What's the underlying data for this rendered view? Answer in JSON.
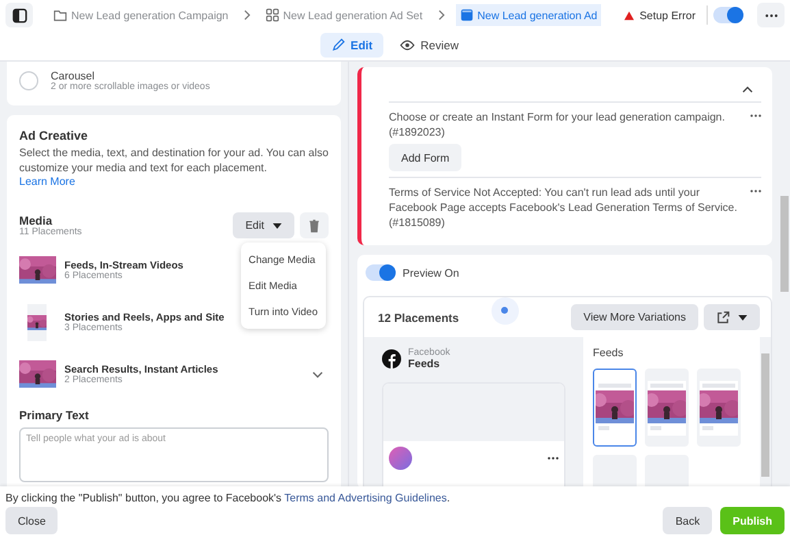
{
  "topbar": {
    "breadcrumbs": [
      {
        "label": "New Lead generation Campaign",
        "kind": "campaign",
        "selected": false
      },
      {
        "label": "New Lead generation Ad Set",
        "kind": "adset",
        "selected": false
      },
      {
        "label": "New Lead generation Ad",
        "kind": "ad",
        "selected": true
      }
    ],
    "status": {
      "label": "Setup Error"
    },
    "toggle": {
      "on": true
    }
  },
  "tabs": [
    {
      "label": "Edit",
      "kind": "edit",
      "selected": true
    },
    {
      "label": "Review",
      "kind": "review",
      "selected": false
    }
  ],
  "format_options": [
    {
      "title": "Carousel",
      "description": "2 or more scrollable images or videos",
      "selected": false
    }
  ],
  "ad_creative": {
    "title": "Ad Creative",
    "description": "Select the media, text, and destination for your ad. You can also customize your media and text for each placement.",
    "link": "Learn More",
    "media": {
      "label": "Media",
      "count": "11 Placements",
      "edit_button": "Edit",
      "menu": [
        "Change Media",
        "Edit Media",
        "Turn into Video"
      ],
      "placements": [
        {
          "title": "Feeds, In-Stream Videos",
          "count": "6 Placements",
          "kind": "wide",
          "expandable": false
        },
        {
          "title": "Stories and Reels, Apps and Site",
          "count": "3 Placements",
          "kind": "tall",
          "expandable": false
        },
        {
          "title": "Search Results, Instant Articles",
          "count": "2 Placements",
          "kind": "wide",
          "expandable": true
        }
      ]
    },
    "primary_text": {
      "label": "Primary Text",
      "placeholder": "Tell people what your ad is about"
    }
  },
  "errors": {
    "expanded": true,
    "items": [
      {
        "message": "Choose or create an Instant Form for your lead generation campaign. (#1892023)",
        "button": "Add Form"
      },
      {
        "message": "Terms of Service Not Accepted: You can't run lead ads until your Facebook Page accepts Facebook's Lead Generation Terms of Service. (#1815089)"
      }
    ]
  },
  "preview": {
    "label": "Preview On",
    "on": true
  },
  "placements": {
    "title": "12 Placements",
    "variations_button": "View More Variations",
    "preview": {
      "platform": "Facebook",
      "position": "Feeds"
    },
    "gallery": {
      "title": "Feeds",
      "thumbnails": [
        {
          "kind": "post",
          "selected": true
        },
        {
          "kind": "post",
          "selected": false
        },
        {
          "kind": "post",
          "selected": false
        },
        {
          "kind": "empty",
          "selected": false
        },
        {
          "kind": "empty",
          "selected": false
        }
      ]
    }
  },
  "footer": {
    "notice_before": "By clicking the \"Publish\" button, you agree to Facebook's ",
    "notice_link": "Terms and Advertising Guidelines",
    "notice_after": ".",
    "close_button": "Close",
    "back_button": "Back",
    "publish_button": "Publish"
  }
}
